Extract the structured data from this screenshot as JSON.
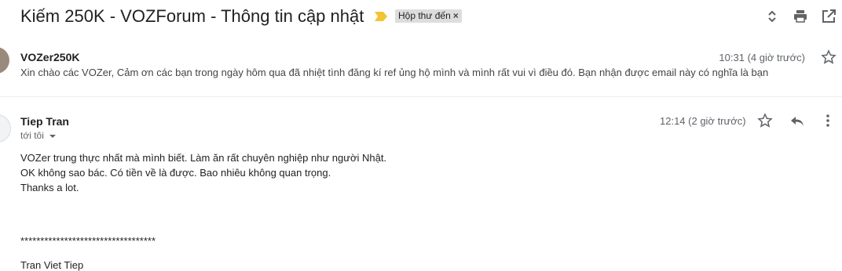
{
  "subject": "Kiếm 250K - VOZForum - Thông tin cập nhật",
  "label_chip": {
    "text": "Hộp thư đến",
    "remove": "×"
  },
  "icons": {
    "importance": "importance-marker-icon",
    "expand": "expand-collapse-icon",
    "print": "print-icon",
    "new_window": "open-in-new-window-icon",
    "star": "star-icon",
    "reply": "reply-icon",
    "more": "more-vertical-icon",
    "caret": "chevron-down-icon"
  },
  "colors": {
    "importance": "#f4c430"
  },
  "messages": [
    {
      "sender": "VOZer250K",
      "time": "10:31 (4 giờ trước)",
      "snippet": "Xin chào các VOZer, Cảm ơn các bạn trong ngày hôm qua đã nhiệt tình đăng kí ref ủng hộ mình và mình rất vui vì điều đó. Bạn nhận được email này có nghĩa là bạn"
    },
    {
      "sender": "Tiep Tran",
      "time": "12:14 (2 giờ trước)",
      "recipient": "tới tôi",
      "body": [
        "VOZer trung thực nhất mà mình biết. Làm ăn rất chuyên nghiệp như người Nhật.",
        "OK không sao bác. Có tiền về là được. Bao nhiêu không quan trọng.",
        "Thanks a lot.",
        "**********************************",
        "Tran Viet Tiep"
      ]
    }
  ]
}
